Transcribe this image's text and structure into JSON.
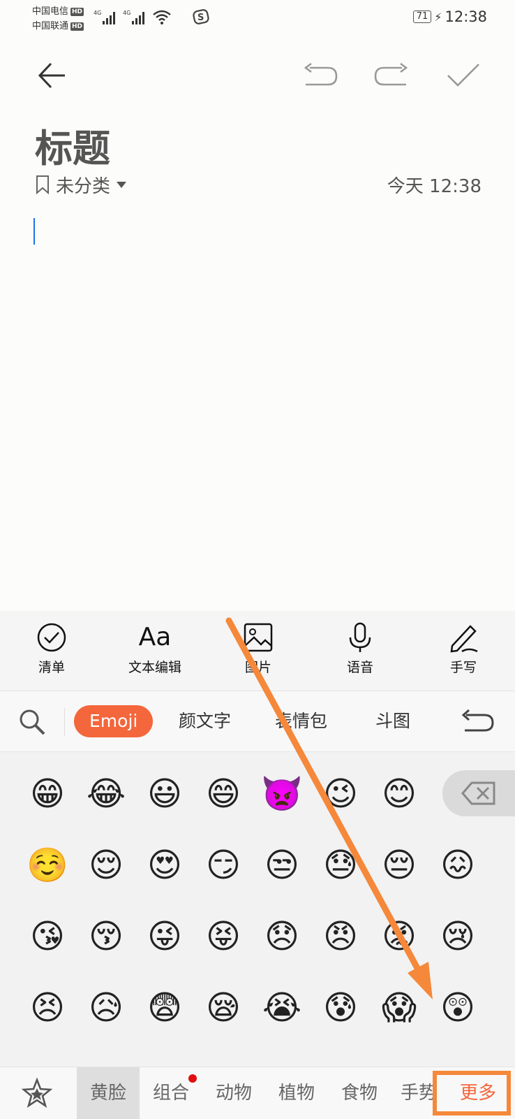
{
  "status_bar": {
    "carrier_1": "中国电信",
    "carrier_2": "中国联通",
    "hd_badge": "HD",
    "network_type": "4G",
    "battery": "71",
    "time": "12:38"
  },
  "toolbar": {
    "icons": [
      "back-arrow-icon",
      "undo-icon",
      "redo-icon",
      "checkmark-icon"
    ]
  },
  "note": {
    "title": "标题",
    "category": "未分类",
    "timestamp": "今天 12:38"
  },
  "tools": [
    {
      "icon": "checklist-icon",
      "label": "清单"
    },
    {
      "icon": "text-format-icon",
      "label": "文本编辑",
      "glyph": "Aa"
    },
    {
      "icon": "image-icon",
      "label": "图片"
    },
    {
      "icon": "microphone-icon",
      "label": "语音"
    },
    {
      "icon": "pen-icon",
      "label": "手写"
    }
  ],
  "keyboard_tabs": {
    "emoji": "Emoji",
    "kaomoji": "颜文字",
    "stickers": "表情包",
    "doutu": "斗图"
  },
  "emoji_rows": [
    [
      "😁",
      "😂",
      "😃",
      "😄",
      "👿",
      "😉",
      "😊"
    ],
    [
      "☺️",
      "😌",
      "😍",
      "😏",
      "😒",
      "😓",
      "😔",
      "😖"
    ],
    [
      "😘",
      "😚",
      "😜",
      "😝",
      "😞",
      "😠",
      "😡",
      "😢"
    ],
    [
      "😣",
      "😥",
      "😨",
      "😪",
      "😭",
      "😰",
      "😱",
      "😲"
    ]
  ],
  "categories": {
    "favorites_icon": "star-icon",
    "items": [
      "黄脸",
      "组合",
      "动物",
      "植物",
      "食物",
      "手势",
      "更多"
    ]
  },
  "colors": {
    "accent": "#f4663b",
    "annotation": "#f5883a",
    "cursor": "#1a73e8"
  }
}
